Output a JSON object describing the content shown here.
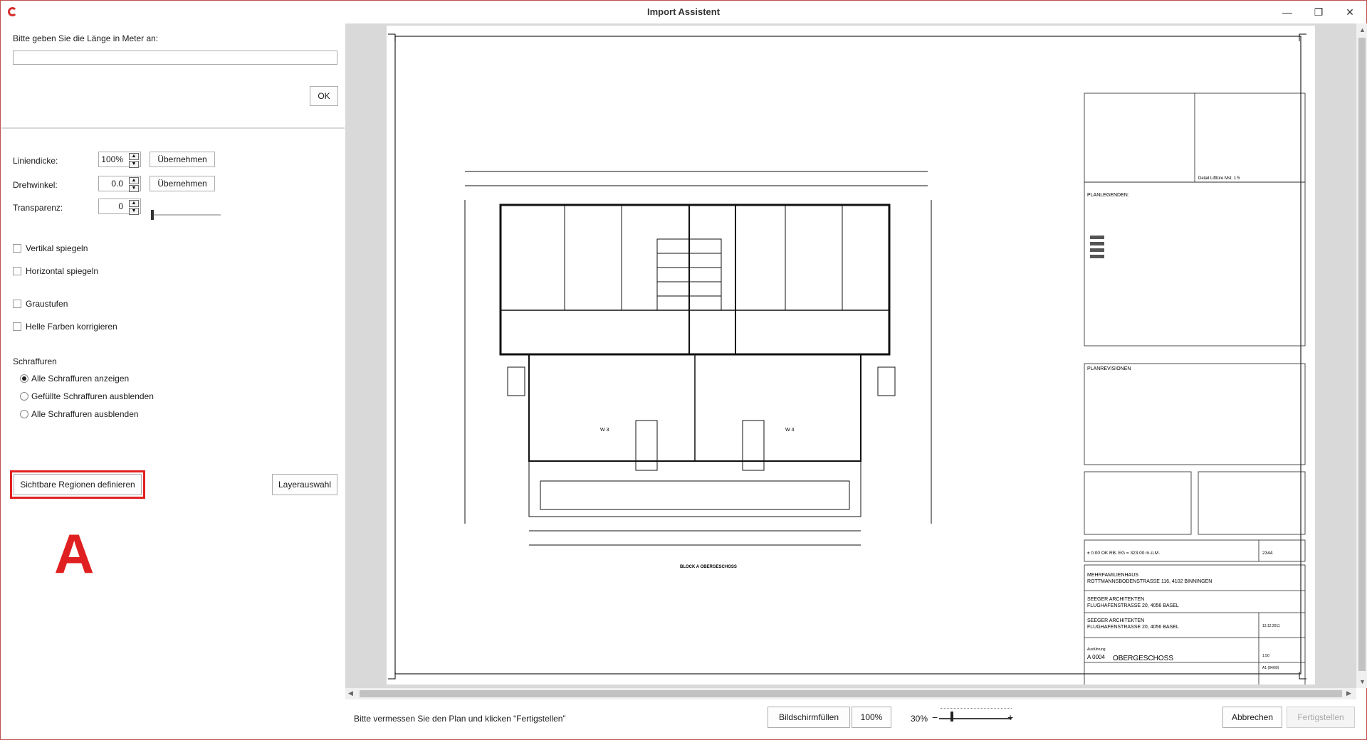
{
  "window": {
    "title": "Import Assistent",
    "minimize": "—",
    "restore": "❐",
    "close": "✕"
  },
  "left": {
    "length_prompt": "Bitte geben Sie die Länge in Meter an:",
    "length_value": "",
    "ok_label": "OK",
    "line_width_label": "Liniendicke:",
    "line_width_value": "100%",
    "rotation_label": "Drehwinkel:",
    "rotation_value": "0.0",
    "transparency_label": "Transparenz:",
    "transparency_value": "0",
    "transparency_level": 0,
    "apply_label": "Übernehmen",
    "flip_vertical": "Vertikal spiegeln",
    "flip_horizontal": "Horizontal spiegeln",
    "grayscale": "Graustufen",
    "correct_light": "Helle Farben korrigieren",
    "hatching_title": "Schraffuren",
    "hatch_options": [
      "Alle Schraffuren anzeigen",
      "Gefüllte Schraffuren ausblenden",
      "Alle Schraffuren ausblenden"
    ],
    "hatch_selected": 0,
    "define_regions": "Sichtbare Regionen definieren",
    "layer_select": "Layerauswahl",
    "annotation_letter": "A"
  },
  "plan": {
    "title_block": {
      "legend_title": "PLANLEGENDEN:",
      "revisions_title": "PLANREVISIONEN",
      "detail_caption": "Detail Lifttüre Mst. 1:5",
      "height_ref": "± 0.00 OK RB. EG = 323.00 m.ü.M.",
      "job_no": "2344",
      "project_line1": "MEHRFAMILIENHAUS",
      "project_line2": "ROTTMANNSBODENSTRASSE 116, 4102 BINNINGEN",
      "client_line1": "SEEGER ARCHITEKTEN",
      "client_line2": "FLUGHAFENSTRASSE 20, 4056 BASEL",
      "architect_line1": "SEEGER ARCHITEKTEN",
      "architect_line2": "FLUGHAFENSTRASSE 20, 4056 BASEL",
      "plan_no": "A 0004",
      "plan_title": "OBERGESCHOSS",
      "scale": "1:50",
      "format": "A1 (84/60)",
      "date": "13.12.2011",
      "phase": "Ausführung"
    },
    "drawing_caption": "BLOCK A OBERGESCHOSS",
    "unit_w3": "W 3",
    "unit_w4": "W 4"
  },
  "bottom": {
    "status_text": "Bitte vermessen Sie den Plan und klicken “Fertigstellen”",
    "fit_screen": "Bildschirmfüllen",
    "zoom_100": "100%",
    "zoom_value": "30%",
    "zoom_minus": "−",
    "zoom_plus": "+",
    "cancel": "Abbrechen",
    "finish": "Fertigstellen"
  }
}
